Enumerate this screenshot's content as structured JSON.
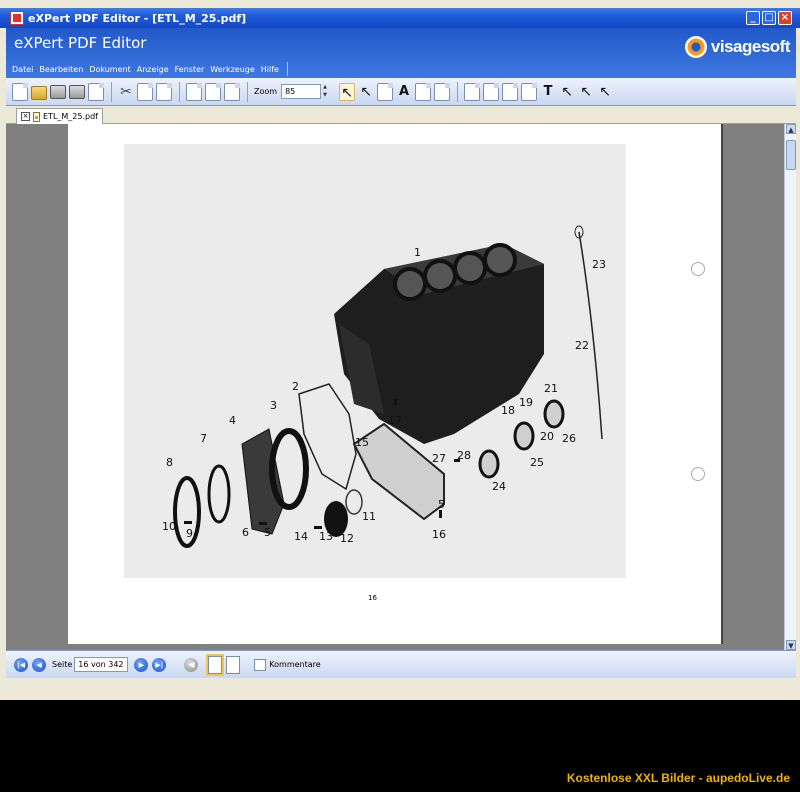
{
  "window": {
    "title": "eXPert PDF Editor - [ETL_M_25.pdf]",
    "controls": [
      "minimize-icon",
      "restore-icon",
      "close-icon"
    ]
  },
  "header": {
    "app_name": "eXPert PDF Editor",
    "logo_text": "visagesoft",
    "logo_accent_color": "#f39c1b"
  },
  "menu": {
    "items": [
      "Datei",
      "Bearbeiten",
      "Dokument",
      "Anzeige",
      "Fenster",
      "Werkzeuge",
      "Hilfe"
    ]
  },
  "toolbar": {
    "zoom_label": "Zoom",
    "zoom_value": "85",
    "text_tool_glyph": "A",
    "typewriter_glyph": "T"
  },
  "tabs": {
    "document_tab": "ETL_M_25.pdf"
  },
  "document": {
    "page_footer_number": "16",
    "figure_callouts": [
      "1",
      "2",
      "3",
      "4",
      "5",
      "6",
      "7",
      "8",
      "9",
      "10",
      "11",
      "12",
      "13",
      "14",
      "15",
      "16",
      "17",
      "18",
      "19",
      "20",
      "21",
      "22",
      "23",
      "24",
      "25",
      "26",
      "27",
      "28"
    ],
    "callout_extra": "5"
  },
  "statusbar": {
    "page_label": "Seite",
    "page_value": "16 von 342",
    "comments_label": "Kommentare"
  },
  "footer": {
    "watermark": "Kostenlose XXL Bilder - aupedoLive.de",
    "watermark_color": "#f0b000"
  }
}
